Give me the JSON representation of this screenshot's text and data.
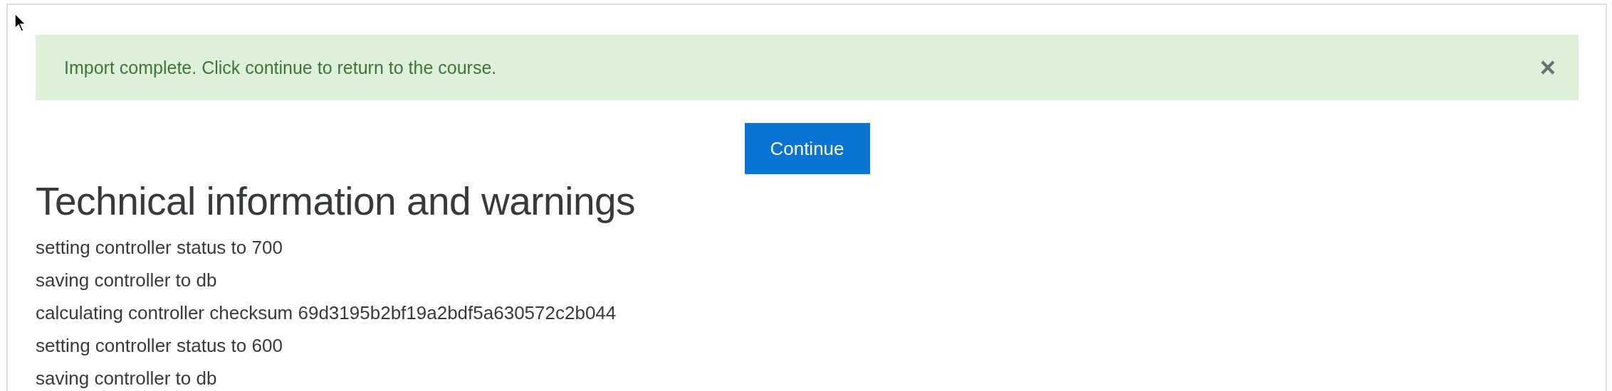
{
  "alert": {
    "message": "Import complete. Click continue to return to the course.",
    "close": "×"
  },
  "continue_button": "Continue",
  "heading": "Technical information and warnings",
  "log_lines": [
    "setting controller status to 700",
    "saving controller to db",
    "calculating controller checksum 69d3195b2bf19a2bdf5a630572c2b044",
    "setting controller status to 600",
    "saving controller to db"
  ]
}
